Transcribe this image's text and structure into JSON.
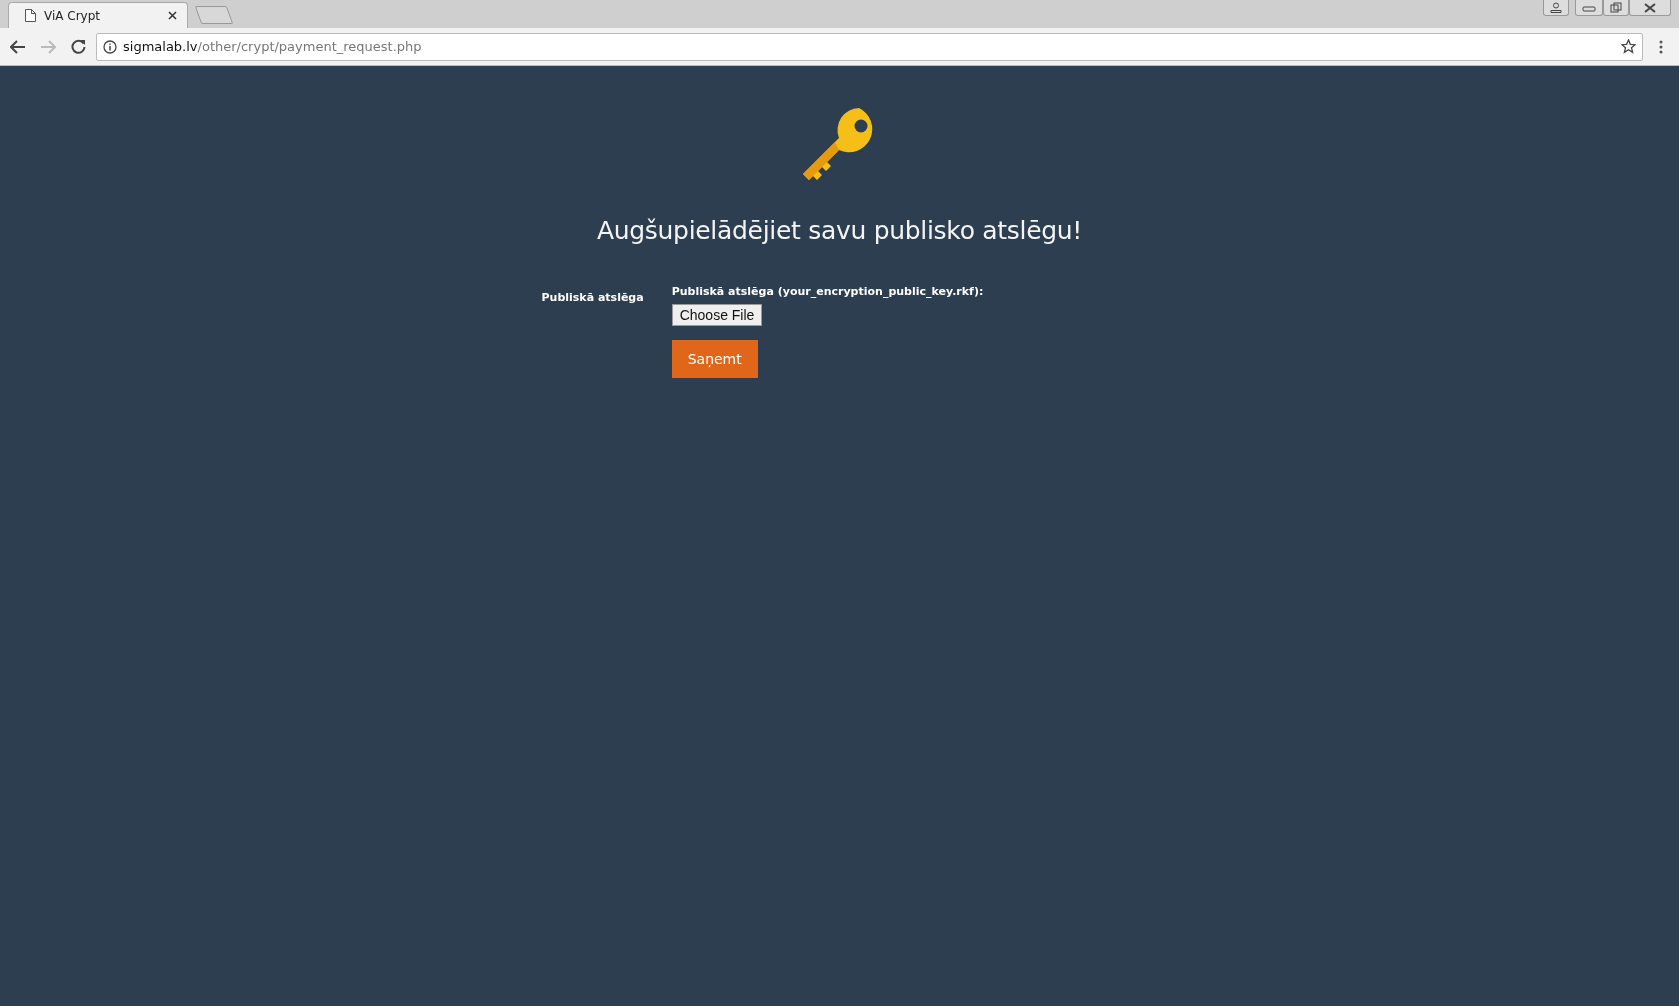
{
  "browser": {
    "tab": {
      "title": "ViA Crypt",
      "selected": true
    },
    "address": {
      "host": "sigmalab.lv",
      "path": "/other/crypt/payment_request.php"
    }
  },
  "page": {
    "heading": "Augšupielādējiet savu publisko atslēgu!",
    "form": {
      "row_label": "Publiskā atslēga",
      "field_label": "Publiskā atslēga (your_encryption_public_key.rkf):",
      "file_button": "Choose File",
      "submit": "Saņemt"
    }
  }
}
